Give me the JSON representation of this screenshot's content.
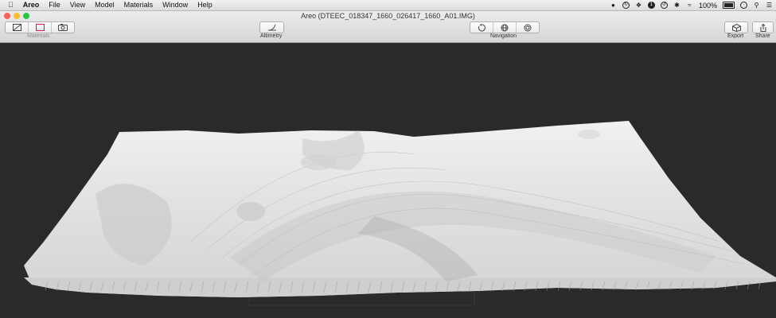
{
  "menubar": {
    "apple_icon": "apple-logo-icon",
    "items": [
      "Areo",
      "File",
      "View",
      "Model",
      "Materials",
      "Window",
      "Help"
    ],
    "status": {
      "battery_percent": "100%",
      "icons": [
        "account-icon",
        "sync-icon",
        "dropbox-icon",
        "1password-icon",
        "time-machine-icon",
        "bluetooth-icon",
        "wifi-icon",
        "battery-icon",
        "clock-icon",
        "spotlight-icon",
        "notification-center-icon"
      ]
    }
  },
  "window": {
    "title": "Areo (DTEEC_018347_1660_026417_1660_A01.IMG)",
    "traffic_colors": {
      "close": "#fc5f57",
      "minimize": "#fdbc2e",
      "zoom": "#28c840"
    }
  },
  "toolbar": {
    "materials_label": "Materials",
    "altimetry_label": "Altimetry",
    "navigation_label": "Navigation",
    "export_label": "Export",
    "share_label": "Share",
    "material_accent": "#e0195f"
  }
}
